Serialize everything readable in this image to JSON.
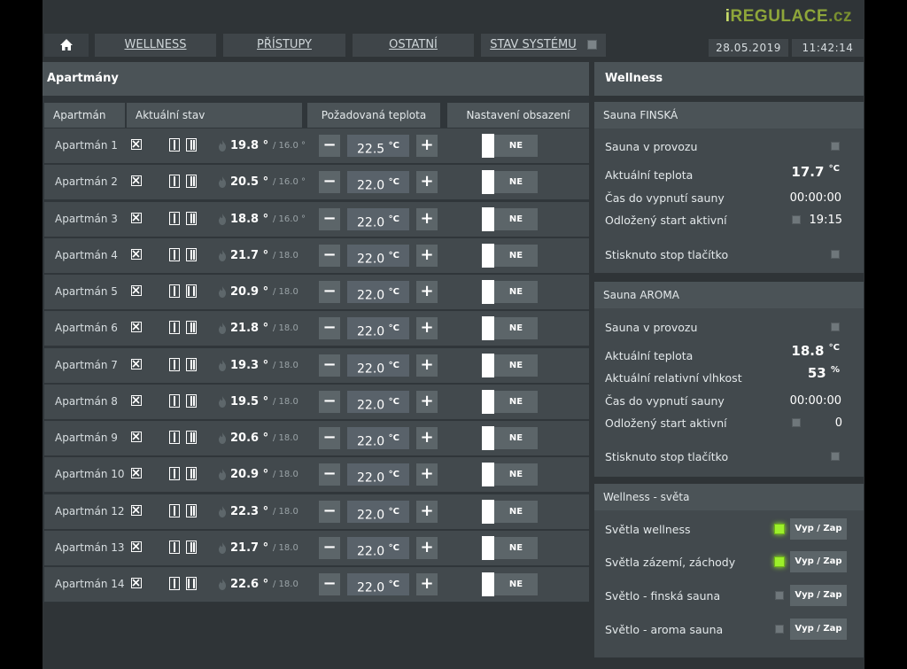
{
  "brand": {
    "logo_i": "i",
    "logo_main": "REGULACE",
    "logo_tld": ".cz"
  },
  "nav": {
    "home_icon": "home-icon",
    "tabs": [
      "WELLNESS",
      "PŘÍSTUPY",
      "OSTATNÍ",
      "STAV SYSTÉMU"
    ],
    "date": "28.05.2019",
    "time": "11:42:14"
  },
  "apartments": {
    "title": "Apartmány",
    "columns": [
      "Apartmán",
      "Aktuální stav",
      "Požadovaná teplota",
      "Nastavení obsazení"
    ],
    "minus_label": "−",
    "plus_label": "+",
    "toggle_label": "NE",
    "rows": [
      {
        "name": "Apartmán 1",
        "temp": "19.8 °",
        "sub": "/ 16.0 °",
        "setpoint": "22.5",
        "unit": "°C",
        "win2_open": false
      },
      {
        "name": "Apartmán 2",
        "temp": "20.5 °",
        "sub": "/ 16.0 °",
        "setpoint": "22.0",
        "unit": "°C",
        "win2_open": false
      },
      {
        "name": "Apartmán 3",
        "temp": "18.8 °",
        "sub": "/ 16.0 °",
        "setpoint": "22.0",
        "unit": "°C",
        "win2_open": false
      },
      {
        "name": "Apartmán 4",
        "temp": "21.7 °",
        "sub": "/ 18.0",
        "setpoint": "22.0",
        "unit": "°C",
        "win2_open": false
      },
      {
        "name": "Apartmán 5",
        "temp": "20.9 °",
        "sub": "/ 18.0",
        "setpoint": "22.0",
        "unit": "°C",
        "win2_open": true
      },
      {
        "name": "Apartmán 6",
        "temp": "21.8 °",
        "sub": "/ 18.0",
        "setpoint": "22.0",
        "unit": "°C",
        "win2_open": false
      },
      {
        "name": "Apartmán 7",
        "temp": "19.3 °",
        "sub": "/ 18.0",
        "setpoint": "22.0",
        "unit": "°C",
        "win2_open": false
      },
      {
        "name": "Apartmán 8",
        "temp": "19.5 °",
        "sub": "/ 18.0",
        "setpoint": "22.0",
        "unit": "°C",
        "win2_open": false
      },
      {
        "name": "Apartmán 9",
        "temp": "20.6 °",
        "sub": "/ 18.0",
        "setpoint": "22.0",
        "unit": "°C",
        "win2_open": false
      },
      {
        "name": "Apartmán 10",
        "temp": "20.9 °",
        "sub": "/ 18.0",
        "setpoint": "22.0",
        "unit": "°C",
        "win2_open": false
      },
      {
        "name": "Apartmán 12",
        "temp": "22.3 °",
        "sub": "/ 18.0",
        "setpoint": "22.0",
        "unit": "°C",
        "win2_open": false
      },
      {
        "name": "Apartmán 13",
        "temp": "21.7 °",
        "sub": "/ 18.0",
        "setpoint": "22.0",
        "unit": "°C",
        "win2_open": false
      },
      {
        "name": "Apartmán 14",
        "temp": "22.6 °",
        "sub": "/ 18.0",
        "setpoint": "22.0",
        "unit": "°C",
        "win2_open": true
      }
    ]
  },
  "wellness": {
    "title": "Wellness",
    "finska": {
      "title": "Sauna FINSKÁ",
      "in_operation": "Sauna v provozu",
      "current_temp_label": "Aktuální teplota",
      "current_temp": "17.7",
      "temp_unit": "°C",
      "time_to_off_label": "Čas do vypnutí sauny",
      "time_to_off": "00:00:00",
      "delayed_label": "Odložený start aktivní",
      "delayed_value": "19:15",
      "stop_label": "Stisknuto stop tlačítko"
    },
    "aroma": {
      "title": "Sauna AROMA",
      "in_operation": "Sauna v provozu",
      "current_temp_label": "Aktuální teplota",
      "current_temp": "18.8",
      "temp_unit": "°C",
      "humidity_label": "Aktuální relativní vlhkost",
      "humidity": "53",
      "humidity_unit": "%",
      "time_to_off_label": "Čas do vypnutí sauny",
      "time_to_off": "00:00:00",
      "delayed_label": "Odložený start aktivní",
      "delayed_value": "0",
      "stop_label": "Stisknuto stop tlačítko"
    },
    "lights": {
      "title": "Wellness - světa",
      "button_label": "Vyp / Zap",
      "items": [
        {
          "label": "Světla wellness",
          "on": true
        },
        {
          "label": "Světla zázemí, záchody",
          "on": true
        },
        {
          "label": "Světlo - finská sauna",
          "on": false
        },
        {
          "label": "Světlo - aroma sauna",
          "on": false
        }
      ]
    }
  }
}
